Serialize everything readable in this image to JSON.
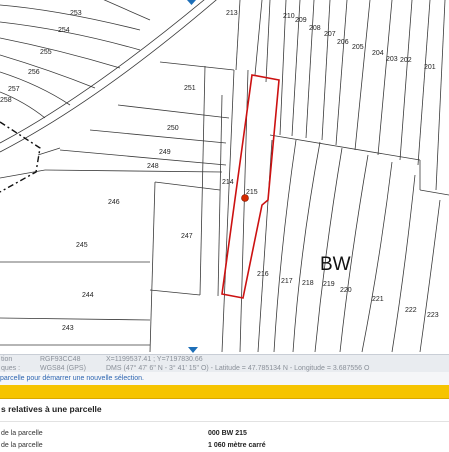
{
  "map": {
    "section_label": "BW",
    "parcels": [
      "253",
      "254",
      "255",
      "256",
      "257",
      "258",
      "213",
      "210",
      "209",
      "208",
      "207",
      "206",
      "205",
      "204",
      "203",
      "202",
      "201",
      "251",
      "250",
      "249",
      "248",
      "214",
      "215",
      "246",
      "247",
      "245",
      "216",
      "217",
      "218",
      "219",
      "220",
      "221",
      "222",
      "223",
      "244",
      "243"
    ],
    "selected_parcel": "215",
    "colors": {
      "parcel_outline": "#3a3a3a",
      "selected_outline": "#cc1111",
      "marker": "#d42a00",
      "nav_arrow": "#1d6fb8"
    }
  },
  "coords_bar": {
    "projection_label_partial": "tion",
    "projection_value": "RGF93CC48",
    "xy": "X=1199537.41 ; Y=7197830.66",
    "wgs_label_partial": "ques :",
    "wgs_value": "WGS84 (GPS)",
    "dms": "DMS (47° 47' 6\" N - 3° 41' 15\" O) - Latitude = 47.785134 N - Longitude = 3.687556 O"
  },
  "hint": "parcelle pour démarrer une nouvelle sélection.",
  "info_panel": {
    "title": "s relatives à une parcelle",
    "rows": [
      {
        "label": "de la parcelle",
        "value": "000 BW 215"
      },
      {
        "label": "de la parcelle",
        "value": "1 060 mètre carré"
      }
    ]
  }
}
